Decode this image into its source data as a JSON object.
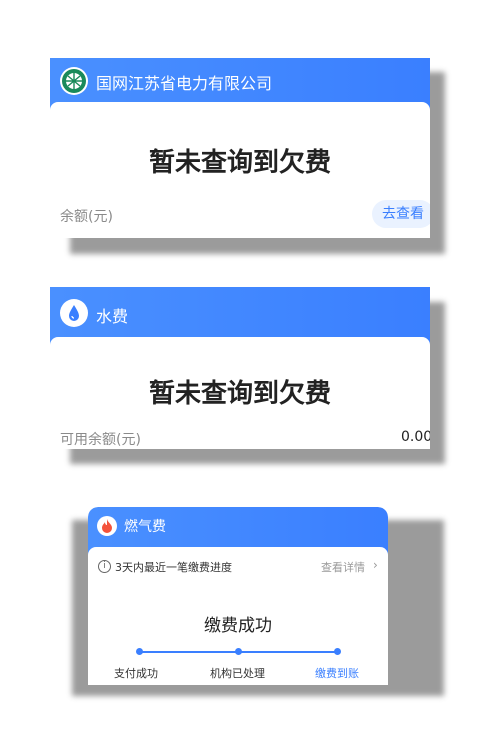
{
  "electric": {
    "company_name": "国网江苏省电力有限公司",
    "status": "暂未查询到欠费",
    "balance_label": "余额(元)",
    "view_button": "去查看"
  },
  "water": {
    "title": "水费",
    "status": "暂未查询到欠费",
    "balance_label": "可用余额(元)",
    "balance_value": "0.00"
  },
  "gas": {
    "title": "燃气费",
    "notice": "3天内最近一笔缴费进度",
    "details_link": "查看详情",
    "status": "缴费成功",
    "steps": [
      "支付成功",
      "机构已处理",
      "缴费到账"
    ]
  },
  "colors": {
    "accent": "#3a7fff",
    "gas_flame": "#f4523b",
    "water_drop": "#3a7fff"
  }
}
